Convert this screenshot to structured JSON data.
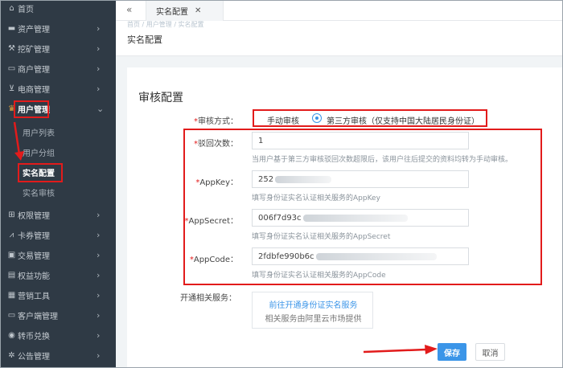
{
  "sidebar": {
    "items": [
      {
        "label": "首页",
        "icon": "home-icon",
        "glyph": "⌂",
        "chevron": ""
      },
      {
        "label": "资产管理",
        "icon": "briefcase-icon",
        "glyph": "▬",
        "chevron": "›"
      },
      {
        "label": "挖矿管理",
        "icon": "pickaxe-icon",
        "glyph": "⚒",
        "chevron": "›"
      },
      {
        "label": "商户管理",
        "icon": "credit-card-icon",
        "glyph": "▭",
        "chevron": "›"
      },
      {
        "label": "电商管理",
        "icon": "cart-icon",
        "glyph": "⊻",
        "chevron": "›"
      },
      {
        "label": "用户管理",
        "icon": "crown-icon",
        "glyph": "♛",
        "chevron": "⌄"
      },
      {
        "label": "权限管理",
        "icon": "network-icon",
        "glyph": "⊞",
        "chevron": "›"
      },
      {
        "label": "卡券管理",
        "icon": "chart-icon",
        "glyph": "⩘",
        "chevron": "›"
      },
      {
        "label": "交易管理",
        "icon": "ticket-icon",
        "glyph": "▣",
        "chevron": "›"
      },
      {
        "label": "权益功能",
        "icon": "wallet-icon",
        "glyph": "▤",
        "chevron": "›"
      },
      {
        "label": "营销工具",
        "icon": "calendar-icon",
        "glyph": "▦",
        "chevron": "›"
      },
      {
        "label": "客户端管理",
        "icon": "monitor-icon",
        "glyph": "▭",
        "chevron": "›"
      },
      {
        "label": "转币兑换",
        "icon": "exchange-icon",
        "glyph": "◉",
        "chevron": "›"
      },
      {
        "label": "公告管理",
        "icon": "gear-icon",
        "glyph": "✲",
        "chevron": "›"
      }
    ],
    "sub_items": [
      {
        "label": "用户列表"
      },
      {
        "label": "用户分组"
      },
      {
        "label": "实名配置"
      },
      {
        "label": "实名审核"
      }
    ]
  },
  "tabbar": {
    "back": "«",
    "tab_label": "实名配置",
    "tab_close": "✕"
  },
  "header": {
    "crumb_ghost": "首页 / 用户管理 / 实名配置",
    "title": "实名配置"
  },
  "form": {
    "section_title": "审核配置",
    "review_mode": {
      "label": "审核方式：",
      "options": [
        "手动审核",
        "第三方审核（仅支持中国大陆居民身份证）"
      ],
      "selected_index": 1
    },
    "reject_count": {
      "label": "驳回次数：",
      "value": "1",
      "hint": "当用户基于第三方审核驳回次数超限后，该用户往后提交的资料均转为手动审核。"
    },
    "appkey": {
      "label": "AppKey：",
      "value": "252",
      "hint": "填写身份证实名认证相关服务的AppKey"
    },
    "appsecret": {
      "label": "AppSecret：",
      "value": "006f7d93c",
      "hint": "填写身份证实名认证相关服务的AppSecret"
    },
    "appcode": {
      "label": "AppCode：",
      "value": "2fdbfe990b6c",
      "hint": "填写身份证实名认证相关服务的AppCode"
    },
    "service": {
      "label": "开通相关服务：",
      "link": "前往开通身份证实名服务",
      "note": "相关服务由阿里云市场提供"
    },
    "required_mark": "*"
  },
  "actions": {
    "save": "保存",
    "cancel": "取消"
  },
  "colors": {
    "sidebar_bg": "#2f3a45",
    "accent": "#3b95e8",
    "annotation_red": "#e21b1b"
  }
}
